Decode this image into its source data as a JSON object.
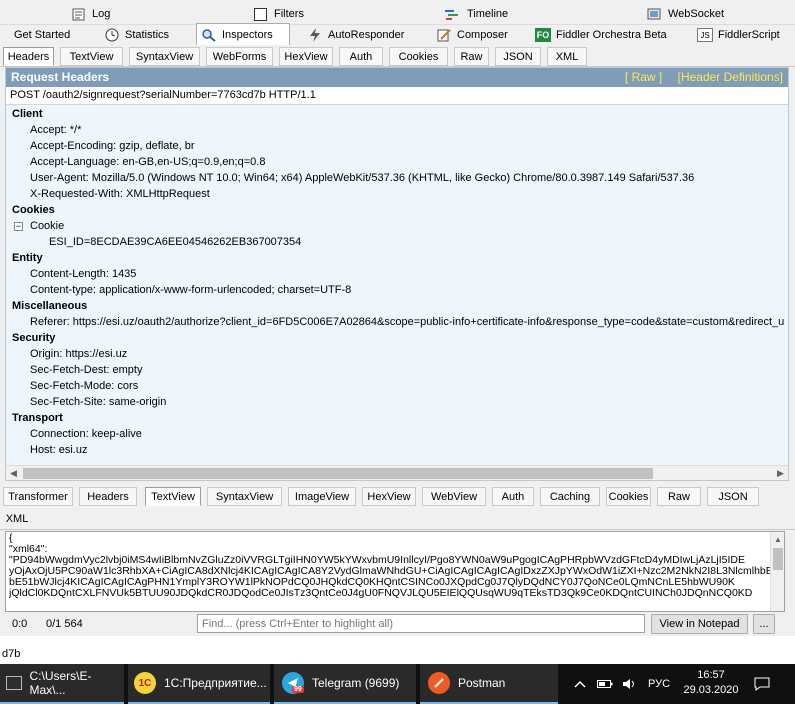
{
  "top_tabs_row1": [
    {
      "label": "Log",
      "icon": "log-icon"
    },
    {
      "label": "Filters",
      "icon": "checkbox-icon"
    },
    {
      "label": "Timeline",
      "icon": "timeline-icon"
    },
    {
      "label": "WebSocket",
      "icon": "websocket-icon"
    }
  ],
  "top_tabs_row2": [
    {
      "label": "Get Started",
      "icon": ""
    },
    {
      "label": "Statistics",
      "icon": "clock-icon"
    },
    {
      "label": "Inspectors",
      "icon": "magnifier-icon"
    },
    {
      "label": "AutoResponder",
      "icon": "lightning-icon"
    },
    {
      "label": "Composer",
      "icon": "composer-icon"
    },
    {
      "label": "Fiddler Orchestra Beta",
      "icon": "fo-icon",
      "icon_text": "FO"
    },
    {
      "label": "FiddlerScript",
      "icon": "script-icon",
      "icon_text": "JS"
    }
  ],
  "request_tabs": [
    "Headers",
    "TextView",
    "SyntaxView",
    "WebForms",
    "HexView",
    "Auth",
    "Cookies",
    "Raw",
    "JSON",
    "XML"
  ],
  "request_panel": {
    "title": "Request Headers",
    "link_raw": "[ Raw ]",
    "link_defs": "[Header Definitions]",
    "request_line": "POST /oauth2/signrequest?serialNumber=7763cd7b HTTP/1.1",
    "sections": {
      "client": "Client",
      "cookies": "Cookies",
      "entity": "Entity",
      "misc": "Miscellaneous",
      "security": "Security",
      "transport": "Transport"
    },
    "headers": {
      "accept": "Accept: */*",
      "accept_encoding": "Accept-Encoding: gzip, deflate, br",
      "accept_language": "Accept-Language: en-GB,en-US;q=0.9,en;q=0.8",
      "user_agent": "User-Agent: Mozilla/5.0 (Windows NT 10.0; Win64; x64) AppleWebKit/537.36 (KHTML, like Gecko) Chrome/80.0.3987.149 Safari/537.36",
      "x_requested_with": "X-Requested-With: XMLHttpRequest",
      "cookie_label": "Cookie",
      "cookie_value": "ESI_ID=8ECDAE39CA6EE04546262EB367007354",
      "content_length": "Content-Length: 1435",
      "content_type": "Content-type: application/x-www-form-urlencoded; charset=UTF-8",
      "referer": "Referer: https://esi.uz/oauth2/authorize?client_id=6FD5C006E7A02864&scope=public-info+certificate-info&response_type=code&state=custom&redirect_u",
      "origin": "Origin: https://esi.uz",
      "sec_fetch_dest": "Sec-Fetch-Dest: empty",
      "sec_fetch_mode": "Sec-Fetch-Mode: cors",
      "sec_fetch_site": "Sec-Fetch-Site: same-origin",
      "connection": "Connection: keep-alive",
      "host": "Host: esi.uz"
    }
  },
  "response_tabs": [
    "Transformer",
    "Headers",
    "TextView",
    "SyntaxView",
    "ImageView",
    "HexView",
    "WebView",
    "Auth",
    "Caching",
    "Cookies",
    "Raw",
    "JSON",
    "XML"
  ],
  "response_text": [
    "{",
    "  \"xml64\":",
    "\"PD94bWwgdmVyc2lvbj0iMS4wIiBlbmNvZGluZz0iVVRGLTgiIHN0YW5kYWxvbmU9InllcyI/Pgo8YWN0aW9uPgogICAgPHRpbWVzdGFtcD4yMDIwLjAzLjI5IDE",
    "yOjAxOjU5PC90aW1lc3RhbXA+CiAgICA8dXNlcj4KICAgICAgICA8Y2VydGlmaWNhdGU+CiAgICAgICAgICAgIDxzZXJpYWxOdW1iZXI+Nzc2M2NkN2I8L3NlcmlhbE",
    "bE51bWJlcj4KICAgICAgICAgPHN1YmplY3ROYW1lPkNOPdCQ0JHQkdCQ0KHQntCSINCo0JXQpdCg0J7QlyDQdNCY0J7QoNCe0LQmNCnLE5hbWU90K",
    "jQldCl0KDQntCXLFNVUk5BTUU90JDQkdCR0JDQodCe0JIsTz3QntCe0J4gU0FNQVJLQU5EIElQQUsqWU9qTEksTD3Qk9Ce0KDQntCUINCh0JDQnNCQ0KD"
  ],
  "status": {
    "position": "0:0",
    "count": "0/1 564",
    "find_placeholder": "Find... (press Ctrl+Enter to highlight all)",
    "view_button": "View in Notepad",
    "more_button": "..."
  },
  "stub_text": "d7b",
  "taskbar": {
    "items": [
      {
        "label": "C:\\Users\\E-Max\\...",
        "icon": "console-icon"
      },
      {
        "label": "1C:Предприятие...",
        "icon": "1c-icon",
        "icon_text": "1C"
      },
      {
        "label": "Telegram (9699)",
        "icon": "telegram-icon",
        "badge": "99"
      },
      {
        "label": "Postman",
        "icon": "postman-icon"
      }
    ],
    "lang": "РУС",
    "time": "16:57",
    "date": "29.03.2020"
  }
}
